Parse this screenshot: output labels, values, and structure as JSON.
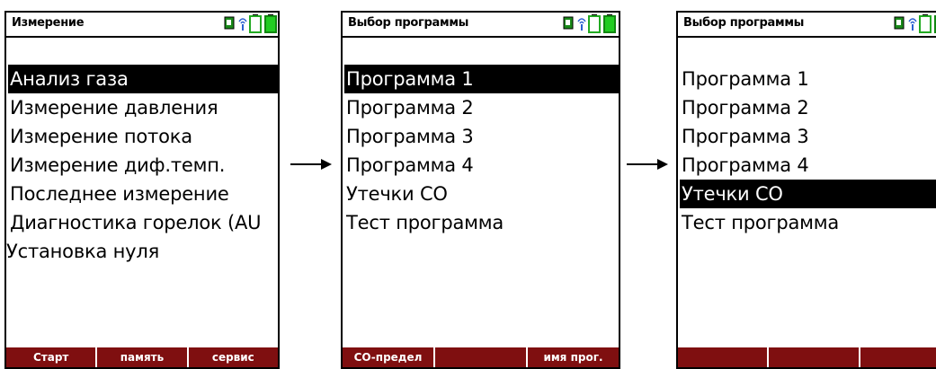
{
  "screens": [
    {
      "title": "Измерение",
      "items": [
        "Анализ газа",
        "Измерение давления",
        "Измерение потока",
        "Измерение диф.темп.",
        "Последнее измерение",
        "Диагностика горелок (AU",
        "Установка нуля"
      ],
      "selected_index": 0,
      "softkeys": [
        "Старт",
        "память",
        "сервис"
      ]
    },
    {
      "title": "Выбор программы",
      "items": [
        "Программа 1",
        "Программа 2",
        "Программа 3",
        "Программа 4",
        "Утечки CO",
        "Тест программа"
      ],
      "selected_index": 0,
      "softkeys": [
        "CO-предел",
        "",
        "имя прог."
      ]
    },
    {
      "title": "Выбор программы",
      "items": [
        "Программа 1",
        "Программа 2",
        "Программа 3",
        "Программа 4",
        "Утечки CO",
        "Тест программа"
      ],
      "selected_index": 4,
      "softkeys": [
        "",
        "",
        ""
      ]
    }
  ],
  "status_icons": [
    "probe-icon",
    "radio-signal-icon",
    "battery-empty-icon",
    "battery-full-icon"
  ],
  "colors": {
    "softkey_bar": "#7f0f10",
    "selection": "#000000",
    "probe_green": "#1a8a1a",
    "battery_green": "#22cc22"
  }
}
